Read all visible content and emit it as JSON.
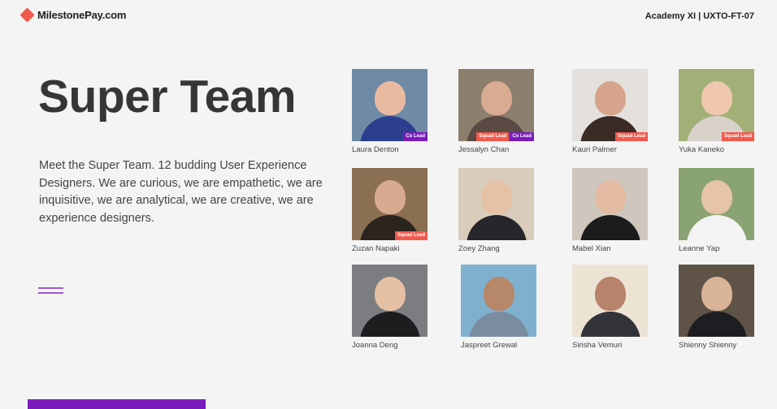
{
  "header": {
    "brand": "MilestonePay.com",
    "cohort": "Academy XI | UXTO-FT-07"
  },
  "hero": {
    "title": "Super Team",
    "intro": "Meet the Super Team. 12 budding User Experience Designers. We are curious, we are empathetic, we are inquisitive, we are analytical, we are creative, we are experience designers."
  },
  "members": [
    {
      "name": "Laura Denton",
      "badges": [
        "Co Lead"
      ],
      "bg": "#6f8aa5",
      "skin": "#e9b9a0",
      "top": "#2c3f8f"
    },
    {
      "name": "Jessalyn Chan",
      "badges": [
        "Squad Lead",
        "Co Lead"
      ],
      "bg": "#8c7f6d",
      "skin": "#d9ab91",
      "top": "#5b4a44"
    },
    {
      "name": "Kauri Palmer",
      "badges": [
        "Squad Lead"
      ],
      "bg": "#e4e0dc",
      "skin": "#d6a48c",
      "top": "#3a2b27"
    },
    {
      "name": "Yuka Kaneko",
      "badges": [
        "Squad Lead"
      ],
      "bg": "#a2b078",
      "skin": "#efc8ad",
      "top": "#d9d2cb"
    },
    {
      "name": "Zuzan Napaki",
      "badges": [
        "Squad Lead"
      ],
      "bg": "#8b6f53",
      "skin": "#d8ab90",
      "top": "#2b241f"
    },
    {
      "name": "Zoey Zhang",
      "badges": [],
      "bg": "#d9ccbd",
      "skin": "#e5c1a5",
      "top": "#26262b"
    },
    {
      "name": "Mabel Xian",
      "badges": [],
      "bg": "#cfc7bd",
      "skin": "#e2bba2",
      "top": "#1c1c1c"
    },
    {
      "name": "Leanne Yap",
      "badges": [],
      "bg": "#8aa372",
      "skin": "#e6c4a6",
      "top": "#f3f3f3"
    },
    {
      "name": "Joanna Deng",
      "badges": [],
      "bg": "#7b7d80",
      "skin": "#e5c0a5",
      "top": "#1d1d1f"
    },
    {
      "name": "Jaspreet Grewal",
      "badges": [],
      "bg": "#7fb1cf",
      "skin": "#b78769",
      "top": "#7a8da0"
    },
    {
      "name": "Sirisha Vemuri",
      "badges": [],
      "bg": "#ede3d4",
      "skin": "#b7836a",
      "top": "#33333a"
    },
    {
      "name": "Shienny Shienny",
      "badges": [],
      "bg": "#5e5346",
      "skin": "#d9b498",
      "top": "#1e1d21"
    }
  ]
}
